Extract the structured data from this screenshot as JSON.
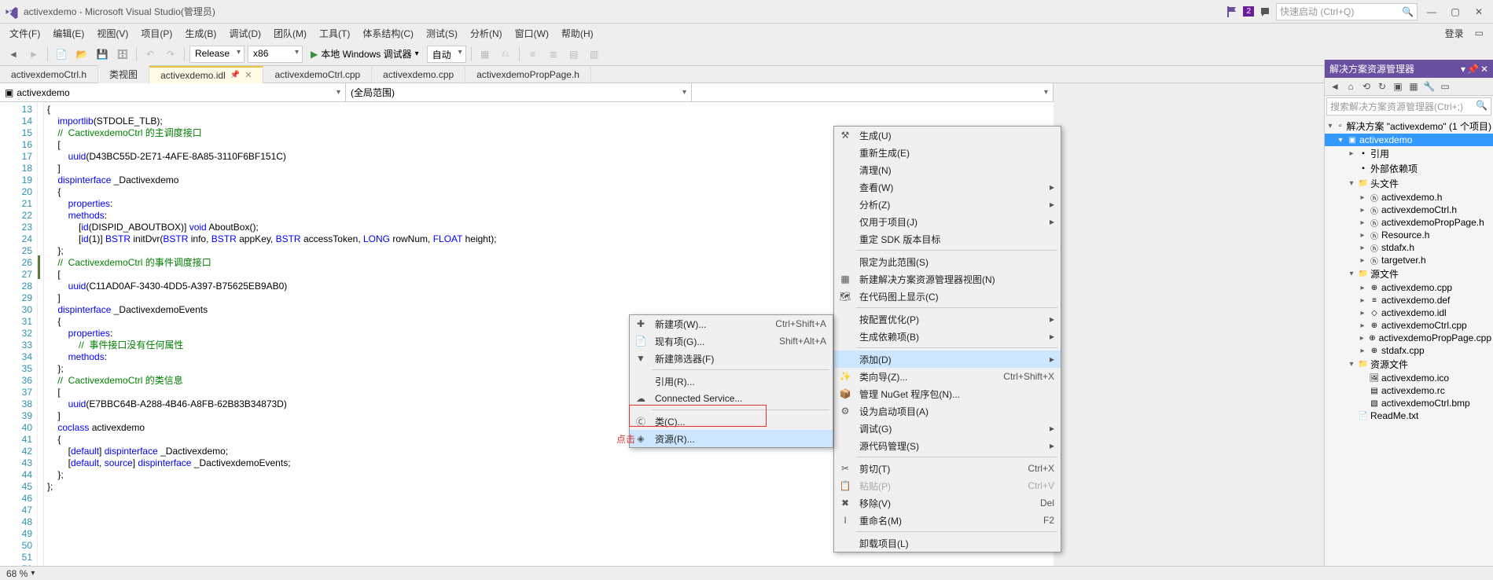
{
  "title": "activexdemo - Microsoft Visual Studio(管理员)",
  "notif_count": "2",
  "quick_launch_placeholder": "快速启动 (Ctrl+Q)",
  "login_text": "登录",
  "menu": [
    "文件(F)",
    "编辑(E)",
    "视图(V)",
    "项目(P)",
    "生成(B)",
    "调试(D)",
    "团队(M)",
    "工具(T)",
    "体系结构(C)",
    "测试(S)",
    "分析(N)",
    "窗口(W)",
    "帮助(H)"
  ],
  "toolbar": {
    "config": "Release",
    "platform": "x86",
    "run_label": "本地 Windows 调试器",
    "run_mode": "自动"
  },
  "doc_tabs": [
    {
      "label": "activexdemoCtrl.h"
    },
    {
      "label": "类视图"
    },
    {
      "label": "activexdemo.idl",
      "active": true,
      "pinned": true,
      "closable": true
    },
    {
      "label": "activexdemoCtrl.cpp"
    },
    {
      "label": "activexdemo.cpp"
    },
    {
      "label": "activexdemoPropPage.h"
    }
  ],
  "nav": {
    "scope": "activexdemo",
    "member": "(全局范围)"
  },
  "line_start": 13,
  "code_lines": [
    "{",
    "    importlib(STDOLE_TLB);",
    "",
    "    //  CactivexdemoCtrl 的主调度接口",
    "    [",
    "        uuid(D43BC55D-2E71-4AFE-8A85-3110F6BF151C)",
    "    ]",
    "    dispinterface _Dactivexdemo",
    "    {",
    "        properties:",
    "        methods:",
    "",
    "            [id(DISPID_ABOUTBOX)] void AboutBox();",
    "            [id(1)] BSTR initDvr(BSTR info, BSTR appKey, BSTR accessToken, LONG rowNum, FLOAT height);",
    "    };",
    "",
    "    //  CactivexdemoCtrl 的事件调度接口",
    "",
    "    [",
    "        uuid(C11AD0AF-3430-4DD5-A397-B75625EB9AB0)",
    "    ]",
    "    dispinterface _DactivexdemoEvents",
    "    {",
    "        properties:",
    "            //  事件接口没有任何属性",
    "",
    "        methods:",
    "    };",
    "",
    "    //  CactivexdemoCtrl 的类信息",
    "    [",
    "        uuid(E7BBC64B-A288-4B46-A8FB-62B83B34873D)",
    "    ]",
    "    coclass activexdemo",
    "    {",
    "        [default] dispinterface _Dactivexdemo;",
    "        [default, source] dispinterface _DactivexdemoEvents;",
    "    };",
    "",
    "};"
  ],
  "green_markers": [
    26,
    27
  ],
  "status_zoom": "68 %",
  "solexp": {
    "title": "解决方案资源管理器",
    "search_placeholder": "搜索解决方案资源管理器(Ctrl+;)",
    "solution_label": "解决方案 \"activexdemo\" (1 个项目)",
    "project": "activexdemo",
    "refs": "引用",
    "ext": "外部依赖项",
    "headers": {
      "label": "头文件",
      "items": [
        "activexdemo.h",
        "activexdemoCtrl.h",
        "activexdemoPropPage.h",
        "Resource.h",
        "stdafx.h",
        "targetver.h"
      ]
    },
    "sources": {
      "label": "源文件",
      "items": [
        "activexdemo.cpp",
        "activexdemo.def",
        "activexdemo.idl",
        "activexdemoCtrl.cpp",
        "activexdemoPropPage.cpp",
        "stdafx.cpp"
      ]
    },
    "resources": {
      "label": "资源文件",
      "items": [
        "activexdemo.ico",
        "activexdemo.rc",
        "activexdemoCtrl.bmp"
      ]
    },
    "readme": "ReadMe.txt"
  },
  "ctx_main": [
    {
      "icon": "build",
      "label": "生成(U)"
    },
    {
      "label": "重新生成(E)"
    },
    {
      "label": "清理(N)"
    },
    {
      "label": "查看(W)",
      "arrow": true
    },
    {
      "label": "分析(Z)",
      "arrow": true
    },
    {
      "label": "仅用于项目(J)",
      "arrow": true
    },
    {
      "label": "重定 SDK 版本目标"
    },
    {
      "sep": true
    },
    {
      "label": "限定为此范围(S)"
    },
    {
      "icon": "new-view",
      "label": "新建解决方案资源管理器视图(N)"
    },
    {
      "icon": "code-map",
      "label": "在代码图上显示(C)"
    },
    {
      "sep": true
    },
    {
      "label": "按配置优化(P)",
      "arrow": true
    },
    {
      "label": "生成依赖项(B)",
      "arrow": true
    },
    {
      "sep": true
    },
    {
      "label": "添加(D)",
      "arrow": true,
      "hl": true
    },
    {
      "icon": "wizard",
      "label": "类向导(Z)...",
      "shortcut": "Ctrl+Shift+X"
    },
    {
      "icon": "nuget",
      "label": "管理 NuGet 程序包(N)..."
    },
    {
      "icon": "startup",
      "label": "设为启动项目(A)"
    },
    {
      "label": "调试(G)",
      "arrow": true
    },
    {
      "label": "源代码管理(S)",
      "arrow": true
    },
    {
      "sep": true
    },
    {
      "icon": "cut",
      "label": "剪切(T)",
      "shortcut": "Ctrl+X"
    },
    {
      "icon": "paste",
      "label": "粘贴(P)",
      "shortcut": "Ctrl+V",
      "dis": true
    },
    {
      "icon": "delete",
      "label": "移除(V)",
      "shortcut": "Del"
    },
    {
      "icon": "rename",
      "label": "重命名(M)",
      "shortcut": "F2"
    },
    {
      "sep": true
    },
    {
      "label": "卸载项目(L)"
    }
  ],
  "ctx_sub": [
    {
      "icon": "new-item",
      "label": "新建项(W)...",
      "shortcut": "Ctrl+Shift+A"
    },
    {
      "icon": "existing",
      "label": "现有项(G)...",
      "shortcut": "Shift+Alt+A"
    },
    {
      "icon": "filter",
      "label": "新建筛选器(F)"
    },
    {
      "sep": true
    },
    {
      "label": "引用(R)..."
    },
    {
      "icon": "connected",
      "label": "Connected Service..."
    },
    {
      "sep": true
    },
    {
      "icon": "class",
      "label": "类(C)..."
    },
    {
      "icon": "resource",
      "label": "资源(R)...",
      "hl": true
    }
  ],
  "annot": "点击"
}
